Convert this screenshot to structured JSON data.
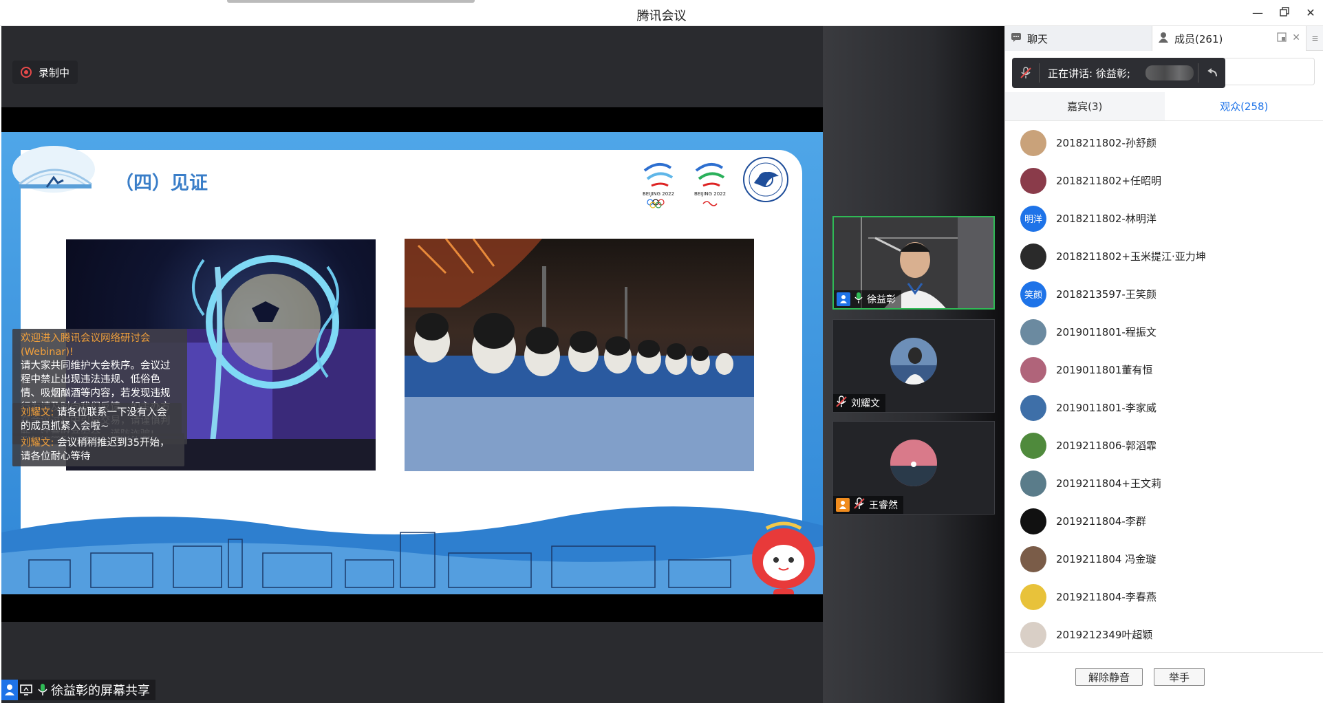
{
  "window": {
    "title": "腾讯会议"
  },
  "recording": {
    "label": "录制中"
  },
  "slide": {
    "heading": "（四）见证"
  },
  "notices": [
    {
      "highlight": "欢迎进入腾讯会议网络研讨会(Webinar)!",
      "text": "请大家共同维护大会秩序。会议过程中禁止出现违法违规、低俗色情、吸烟酗酒等内容，若发现违规行为请及时向我们反馈。如主办方在会议过程中引导交易，请谨慎判断，注意财产安全，谨防诈骗!"
    },
    {
      "highlight": "刘耀文:",
      "text": "请各位联系一下没有入会的成员抓紧入会啦~"
    },
    {
      "highlight": "刘耀文:",
      "text": "会议稍稍推迟到35开始，请各位耐心等待"
    }
  ],
  "share": {
    "label": "徐益彰的屏幕共享"
  },
  "tiles": [
    {
      "name": "徐益彰"
    },
    {
      "name": "刘耀文"
    },
    {
      "name": "王睿然"
    }
  ],
  "panel": {
    "tab_chat": "聊天",
    "tab_members": "成员(261)",
    "speaking": "正在讲话: 徐益彰;",
    "sub_guests": "嘉宾(3)",
    "sub_audience": "观众(258)",
    "btn_unmute": "解除静音",
    "btn_raise": "举手"
  },
  "members": [
    {
      "name": "2018211802-孙舒颜",
      "color": "#c9a27a"
    },
    {
      "name": "2018211802+任昭明",
      "color": "#8a3b4a"
    },
    {
      "name": "2018211802-林明洋",
      "color": "#1e73e8",
      "initials": "明洋"
    },
    {
      "name": "2018211802+玉米提江·亚力坤",
      "color": "#2a2a2a"
    },
    {
      "name": "2018213597-王笑颜",
      "color": "#1e73e8",
      "initials": "笑颜"
    },
    {
      "name": "2019011801-程振文",
      "color": "#6b8aa0"
    },
    {
      "name": "2019011801董有恒",
      "color": "#b0647a"
    },
    {
      "name": "2019011801-李家威",
      "color": "#3e6fa8"
    },
    {
      "name": "2019211806-郭滔霏",
      "color": "#4f8a3c"
    },
    {
      "name": "2019211804+王文莉",
      "color": "#5a7c8a"
    },
    {
      "name": "2019211804-李群",
      "color": "#111111"
    },
    {
      "name": "2019211804 冯金璇",
      "color": "#7a5c48"
    },
    {
      "name": "2019211804-李春燕",
      "color": "#e8c23a"
    },
    {
      "name": "2019212349叶超颖",
      "color": "#d9cfc6"
    }
  ]
}
